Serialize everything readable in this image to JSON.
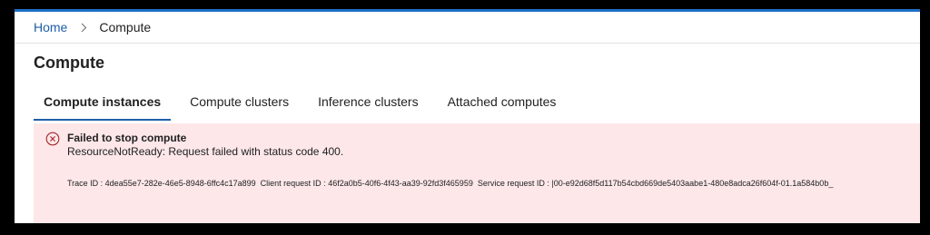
{
  "breadcrumb": {
    "home": "Home",
    "current": "Compute"
  },
  "page": {
    "title": "Compute"
  },
  "tabs": [
    {
      "label": "Compute instances",
      "active": true
    },
    {
      "label": "Compute clusters",
      "active": false
    },
    {
      "label": "Inference clusters",
      "active": false
    },
    {
      "label": "Attached computes",
      "active": false
    }
  ],
  "error": {
    "icon": "error-circle-icon",
    "title": "Failed to stop compute",
    "message": "ResourceNotReady: Request failed with status code 400.",
    "trace_id": "Trace ID : 4dea55e7-282e-46e5-8948-6ffc4c17a899",
    "client_request_id": "Client request ID : 46f2a0b5-40f6-4f43-aa39-92fd3f465959",
    "service_request_id": "Service request ID : |00-e92d68f5d117b54cbd669de5403aabe1-480e8adca26f604f-01.1a584b0b_"
  },
  "colors": {
    "accent": "#1f6fc5",
    "error_background": "#fde7e9",
    "error_icon": "#a4262c"
  }
}
